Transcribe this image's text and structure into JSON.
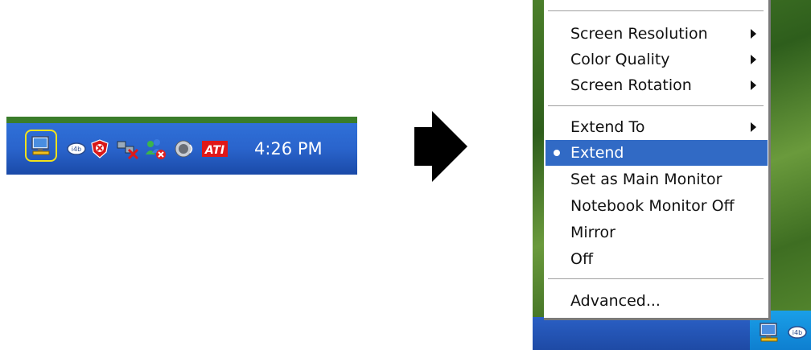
{
  "taskbar": {
    "clock": "4:26 PM",
    "icons": [
      "network-monitor-icon",
      "intel-graphics-icon",
      "security-shield-icon",
      "network-disconnected-icon",
      "messenger-icon",
      "volume-icon",
      "ati-icon"
    ],
    "ati_label": "ATI",
    "intel_label": "i4b"
  },
  "menu": {
    "items": [
      {
        "label": "Screen Resolution",
        "submenu": true
      },
      {
        "label": "Color Quality",
        "submenu": true
      },
      {
        "label": "Screen Rotation",
        "submenu": true
      },
      {
        "label": "Extend To",
        "submenu": true
      },
      {
        "label": "Extend",
        "selected": true
      },
      {
        "label": "Set as Main Monitor"
      },
      {
        "label": "Notebook Monitor Off"
      },
      {
        "label": "Mirror"
      },
      {
        "label": "Off"
      },
      {
        "label": "Advanced..."
      }
    ]
  },
  "colors": {
    "taskbar": "#2a64cc",
    "highlight": "#316ac5",
    "desktop": "#4b7f2a"
  }
}
